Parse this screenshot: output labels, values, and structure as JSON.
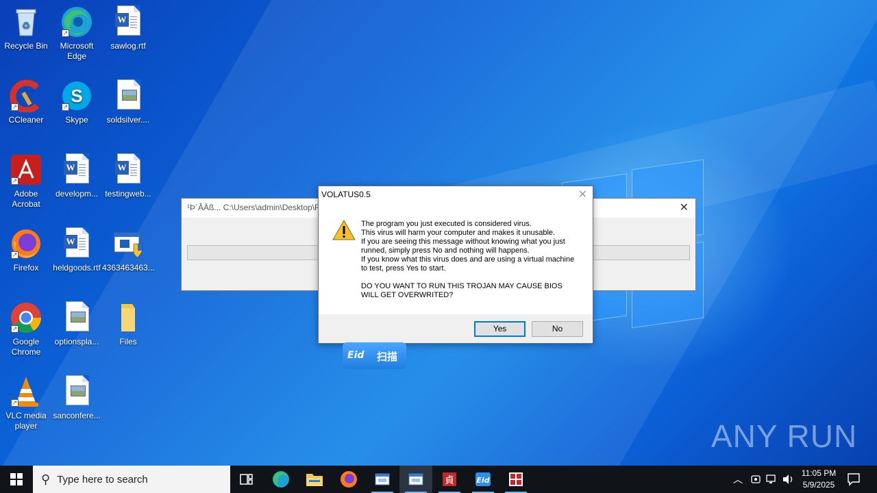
{
  "desktop_icons": [
    {
      "label": "Recycle Bin",
      "icon": "recycle-bin-icon"
    },
    {
      "label": "Microsoft Edge",
      "icon": "edge-icon"
    },
    {
      "label": "sawlog.rtf",
      "icon": "word-doc-icon"
    },
    {
      "label": "CCleaner",
      "icon": "ccleaner-icon"
    },
    {
      "label": "Skype",
      "icon": "skype-icon"
    },
    {
      "label": "soldsilver....",
      "icon": "image-file-icon"
    },
    {
      "label": "Adobe Acrobat",
      "icon": "acrobat-icon"
    },
    {
      "label": "developm...",
      "icon": "word-doc-icon"
    },
    {
      "label": "testingweb...",
      "icon": "word-doc-icon"
    },
    {
      "label": "Firefox",
      "icon": "firefox-icon"
    },
    {
      "label": "heldgoods.rtf",
      "icon": "word-doc-icon"
    },
    {
      "label": "4363463463...",
      "icon": "shield-exe-icon"
    },
    {
      "label": "Google Chrome",
      "icon": "chrome-icon"
    },
    {
      "label": "optionspla...",
      "icon": "image-file-icon"
    },
    {
      "label": "Files",
      "icon": "folder-icon"
    },
    {
      "label": "VLC media player",
      "icon": "vlc-icon"
    },
    {
      "label": "sanconfere...",
      "icon": "image-file-icon"
    }
  ],
  "background_window": {
    "title": "¹Þ´ÂÀß... C:\\Users\\admin\\Desktop\\F"
  },
  "message_box": {
    "title": "VOLATUS0.5",
    "body": "The program you just executed is considered virus.\nThis virus will harm your computer and makes it unusable.\nIf you are seeing this message without knowing what you just runned, simply press No and nothing will happens.\nIf you know what this virus does and are using a virtual machine to test, press Yes to start.\n\nDO YOU WANT TO RUN THIS TROJAN MAY CAUSE BIOS WILL GET OVERWRITED?",
    "yes_label": "Yes",
    "no_label": "No"
  },
  "eid_widget": {
    "logo": "Eid",
    "label": "扫描"
  },
  "watermark": "ANY RUN",
  "taskbar": {
    "search_placeholder": "Type here to search",
    "time": "11:05 PM",
    "date": "5/9/2025",
    "tray_icons": [
      "chevron-up-icon",
      "meet-now-icon",
      "network-icon",
      "volume-icon"
    ]
  },
  "colors": {
    "accent": "#0078d7",
    "taskbar": "#101418",
    "wallpaper": "#0b63d8"
  }
}
